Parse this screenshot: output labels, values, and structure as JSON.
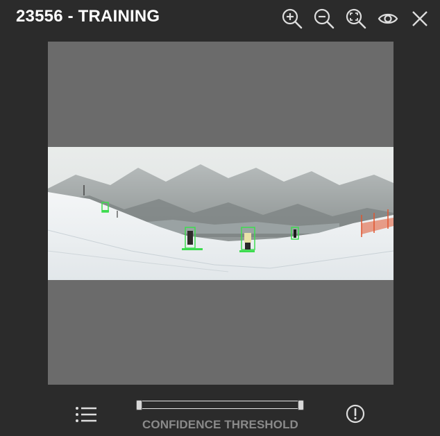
{
  "header": {
    "title": "23556 - TRAINING"
  },
  "toolbar": {
    "icons": [
      "zoom-in-icon",
      "zoom-out-icon",
      "zoom-fit-icon",
      "eye-icon",
      "close-icon"
    ]
  },
  "footer": {
    "list_icon": "list-icon",
    "slider_label": "CONFIDENCE THRESHOLD",
    "alert_icon": "alert-circle-icon",
    "threshold_range": [
      0.0,
      1.0
    ]
  },
  "colors": {
    "background": "#2b2b2b",
    "viewer_background": "#6b6b6b",
    "box_green": "#3ddc4f",
    "label_gray": "#8a8a8a"
  }
}
